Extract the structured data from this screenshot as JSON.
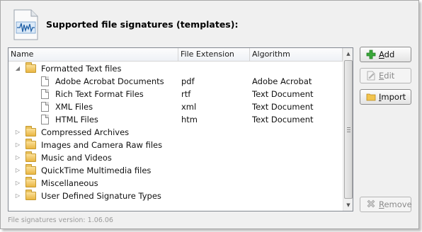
{
  "header": {
    "title": "Supported file signatures (templates):",
    "icon": "file-signature-waveform-icon"
  },
  "table": {
    "columns": [
      "Name",
      "File Extension",
      "Algorithm"
    ],
    "rows": [
      {
        "name": "Formatted Text files",
        "ext": "",
        "algo": "",
        "type": "folder",
        "expanded": true
      },
      {
        "name": "Adobe Acrobat Documents",
        "ext": "pdf",
        "algo": "Adobe Acrobat",
        "type": "file"
      },
      {
        "name": "Rich Text Format Files",
        "ext": "rtf",
        "algo": "Text Document",
        "type": "file"
      },
      {
        "name": "XML Files",
        "ext": "xml",
        "algo": "Text Document",
        "type": "file"
      },
      {
        "name": "HTML Files",
        "ext": "htm",
        "algo": "Text Document",
        "type": "file"
      },
      {
        "name": "Compressed Archives",
        "ext": "",
        "algo": "",
        "type": "folder",
        "expanded": false
      },
      {
        "name": "Images and Camera Raw files",
        "ext": "",
        "algo": "",
        "type": "folder",
        "expanded": false
      },
      {
        "name": "Music and Videos",
        "ext": "",
        "algo": "",
        "type": "folder",
        "expanded": false
      },
      {
        "name": "QuickTime Multimedia files",
        "ext": "",
        "algo": "",
        "type": "folder",
        "expanded": false
      },
      {
        "name": "Miscellaneous",
        "ext": "",
        "algo": "",
        "type": "folder",
        "expanded": false
      },
      {
        "name": "User Defined Signature Types",
        "ext": "",
        "algo": "",
        "type": "folder",
        "expanded": false
      }
    ]
  },
  "buttons": {
    "add": {
      "label_first": "A",
      "label_rest": "dd",
      "icon": "green-plus-icon",
      "enabled": true
    },
    "edit": {
      "label_first": "E",
      "label_rest": "dit",
      "icon": "edit-document-icon",
      "enabled": false
    },
    "import": {
      "label_first": "I",
      "label_rest": "mport",
      "icon": "folder-icon",
      "enabled": true
    },
    "remove": {
      "label_first": "R",
      "label_rest": "emove",
      "icon": "remove-x-icon",
      "enabled": false
    }
  },
  "footer": {
    "version_text": "File signatures version: 1.06.06"
  },
  "colors": {
    "window_bg": "#f0f0f0",
    "add_icon": "#2e9e2e"
  }
}
